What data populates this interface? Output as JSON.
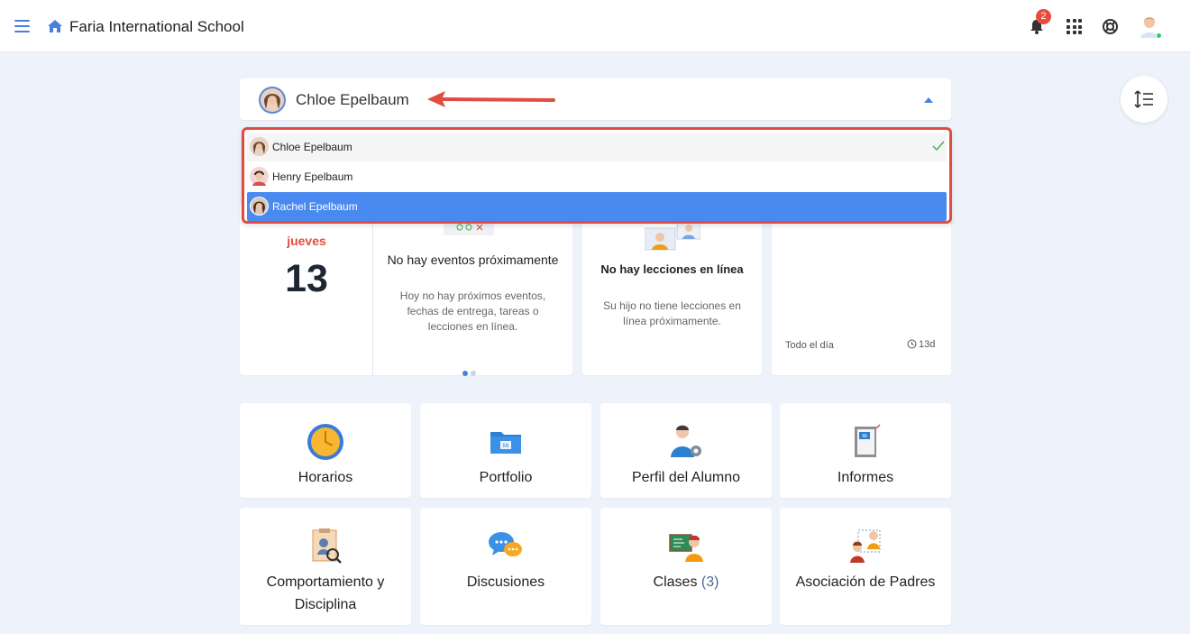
{
  "header": {
    "school_name": "Faria International School",
    "notifications_count": "2"
  },
  "student_selector": {
    "selected": "Chloe Epelbaum",
    "options": [
      {
        "name": "Chloe Epelbaum",
        "checked": true
      },
      {
        "name": "Henry Epelbaum",
        "checked": false
      },
      {
        "name": "Rachel Epelbaum",
        "checked": false,
        "highlighted": true
      }
    ]
  },
  "date_card": {
    "weekday": "jueves",
    "day": "13"
  },
  "events_card": {
    "title": "No hay eventos próximamente",
    "description": "Hoy no hay próximos eventos, fechas de entrega, tareas o lecciones en línea."
  },
  "lessons_card": {
    "title": "No hay lecciones en línea",
    "description": "Su hijo no tiene lecciones en línea próximamente."
  },
  "allday_card": {
    "label": "Todo el día",
    "time": "13d"
  },
  "tiles": [
    {
      "label": "Horarios",
      "icon": "clock-icon"
    },
    {
      "label": "Portfolio",
      "icon": "folder-icon"
    },
    {
      "label": "Perfil del Alumno",
      "icon": "student-profile-icon"
    },
    {
      "label": "Informes",
      "icon": "report-card-icon"
    },
    {
      "label": "Comportamiento y Disciplina",
      "icon": "behaviour-icon"
    },
    {
      "label": "Discusiones",
      "icon": "chat-bubbles-icon"
    },
    {
      "label": "Clases",
      "count": "(3)",
      "icon": "classes-icon"
    },
    {
      "label": "Asociación de Padres",
      "icon": "parents-association-icon"
    }
  ],
  "colors": {
    "accent": "#4a7fdc",
    "highlight": "#4a89f0",
    "annotation_red": "#e24b3f",
    "weekday_red": "#e74c3c"
  }
}
